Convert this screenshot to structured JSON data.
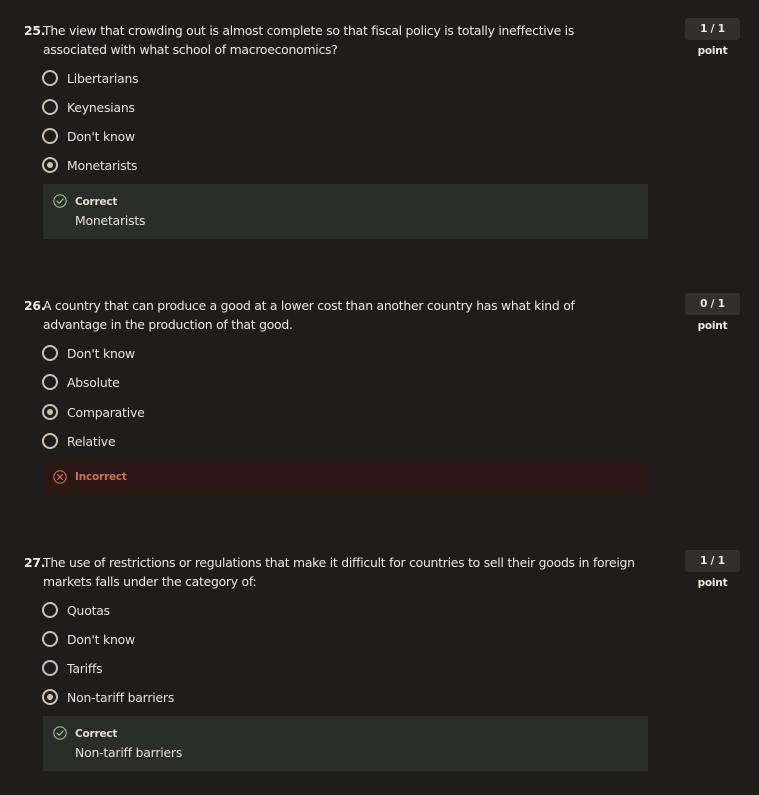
{
  "questions": [
    {
      "number": "25.",
      "text": "The view that crowding out is almost complete so that fiscal policy is totally ineffective is associated with what school of macroeconomics?",
      "score": "1 / 1 point",
      "options": [
        {
          "label": "Libertarians",
          "selected": false
        },
        {
          "label": "Keynesians",
          "selected": false
        },
        {
          "label": "Don't know",
          "selected": false
        },
        {
          "label": "Monetarists",
          "selected": true
        }
      ],
      "feedback": {
        "status": "Correct",
        "answer": "Monetarists"
      }
    },
    {
      "number": "26.",
      "text": "A country that can produce a good at a lower cost than another country has what kind of advantage in the production of that good.",
      "score": "0 / 1 point",
      "options": [
        {
          "label": "Don't know",
          "selected": false
        },
        {
          "label": "Absolute",
          "selected": false
        },
        {
          "label": "Comparative",
          "selected": true
        },
        {
          "label": "Relative",
          "selected": false
        }
      ],
      "feedback": {
        "status": "Incorrect"
      }
    },
    {
      "number": "27.",
      "text": "The use of restrictions or regulations that make it difficult for countries to sell their goods in foreign markets falls under the category of:",
      "score": "1 / 1 point",
      "options": [
        {
          "label": "Quotas",
          "selected": false
        },
        {
          "label": "Don't know",
          "selected": false
        },
        {
          "label": "Tariffs",
          "selected": false
        },
        {
          "label": "Non-tariff barriers",
          "selected": true
        }
      ],
      "feedback": {
        "status": "Correct",
        "answer": "Non-tariff barriers"
      }
    }
  ],
  "colors": {
    "background": "#1f1d1b",
    "correct_feedback_bg": "#2a2d28",
    "incorrect_feedback_bg": "#2b1714",
    "correct_icon": "#9bbf8f",
    "incorrect_icon": "#c6705f"
  },
  "icons": {
    "correct": "check-circle-icon",
    "incorrect": "x-circle-icon"
  }
}
